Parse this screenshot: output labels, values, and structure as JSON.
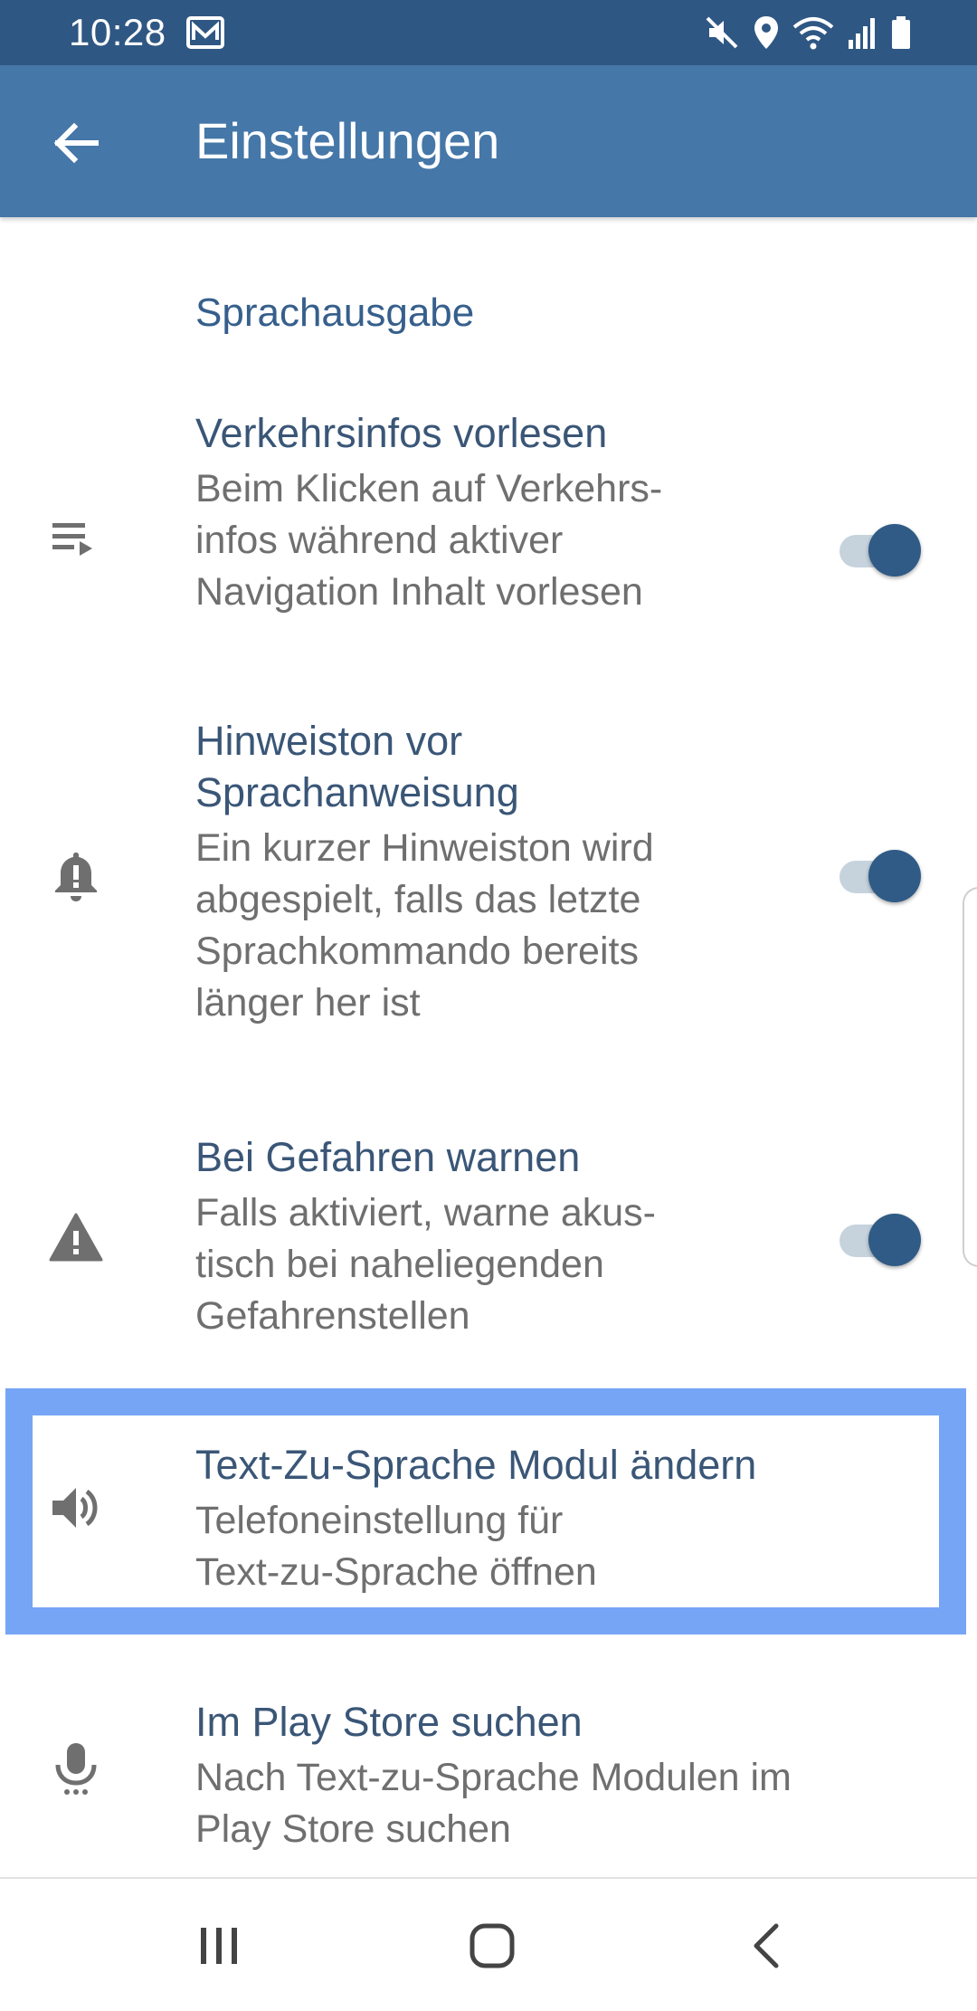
{
  "status_bar": {
    "time": "10:28",
    "icons": [
      "mail-icon",
      "mute-icon",
      "location-icon",
      "wifi-icon",
      "signal-icon",
      "battery-icon"
    ]
  },
  "app_bar": {
    "back_icon": "arrow-back-icon",
    "title": "Einstellungen"
  },
  "section": {
    "header": "Sprachausgabe"
  },
  "items": [
    {
      "icon": "playlist-icon",
      "title": "Verkehrsinfos vorlesen",
      "subtitle_lines": [
        "Beim Klicken auf Verkehrs-",
        "infos während aktiver",
        "Navigation Inhalt vorlesen"
      ],
      "toggle_on": true
    },
    {
      "icon": "bell-alert-icon",
      "title_lines": [
        "Hinweiston vor",
        "Sprachanweisung"
      ],
      "subtitle_lines": [
        "Ein kurzer Hinweiston wird",
        "abgespielt, falls das letzte",
        "Sprachkommando bereits",
        "länger her ist"
      ],
      "toggle_on": true
    },
    {
      "icon": "warning-icon",
      "title": "Bei Gefahren warnen",
      "subtitle_lines": [
        "Falls aktiviert, warne akus-",
        "tisch bei naheliegenden",
        "Gefahrenstellen"
      ],
      "toggle_on": true
    },
    {
      "icon": "speaker-icon",
      "title": "Text-Zu-Sprache Modul ändern",
      "subtitle_lines": [
        "Telefoneinstellung für",
        "Text-zu-Sprache öffnen"
      ]
    },
    {
      "icon": "microphone-icon",
      "title": "Im Play Store suchen",
      "subtitle_lines": [
        "Nach Text-zu-Sprache Modulen im",
        "Play Store suchen"
      ]
    }
  ],
  "colors": {
    "status_bar": "#2f5783",
    "app_bar": "#4577a8",
    "accent": "#2f5b86",
    "highlight": "#76a5f6"
  },
  "nav_bar": {
    "icons": [
      "recent-apps-icon",
      "home-icon",
      "back-icon"
    ]
  }
}
